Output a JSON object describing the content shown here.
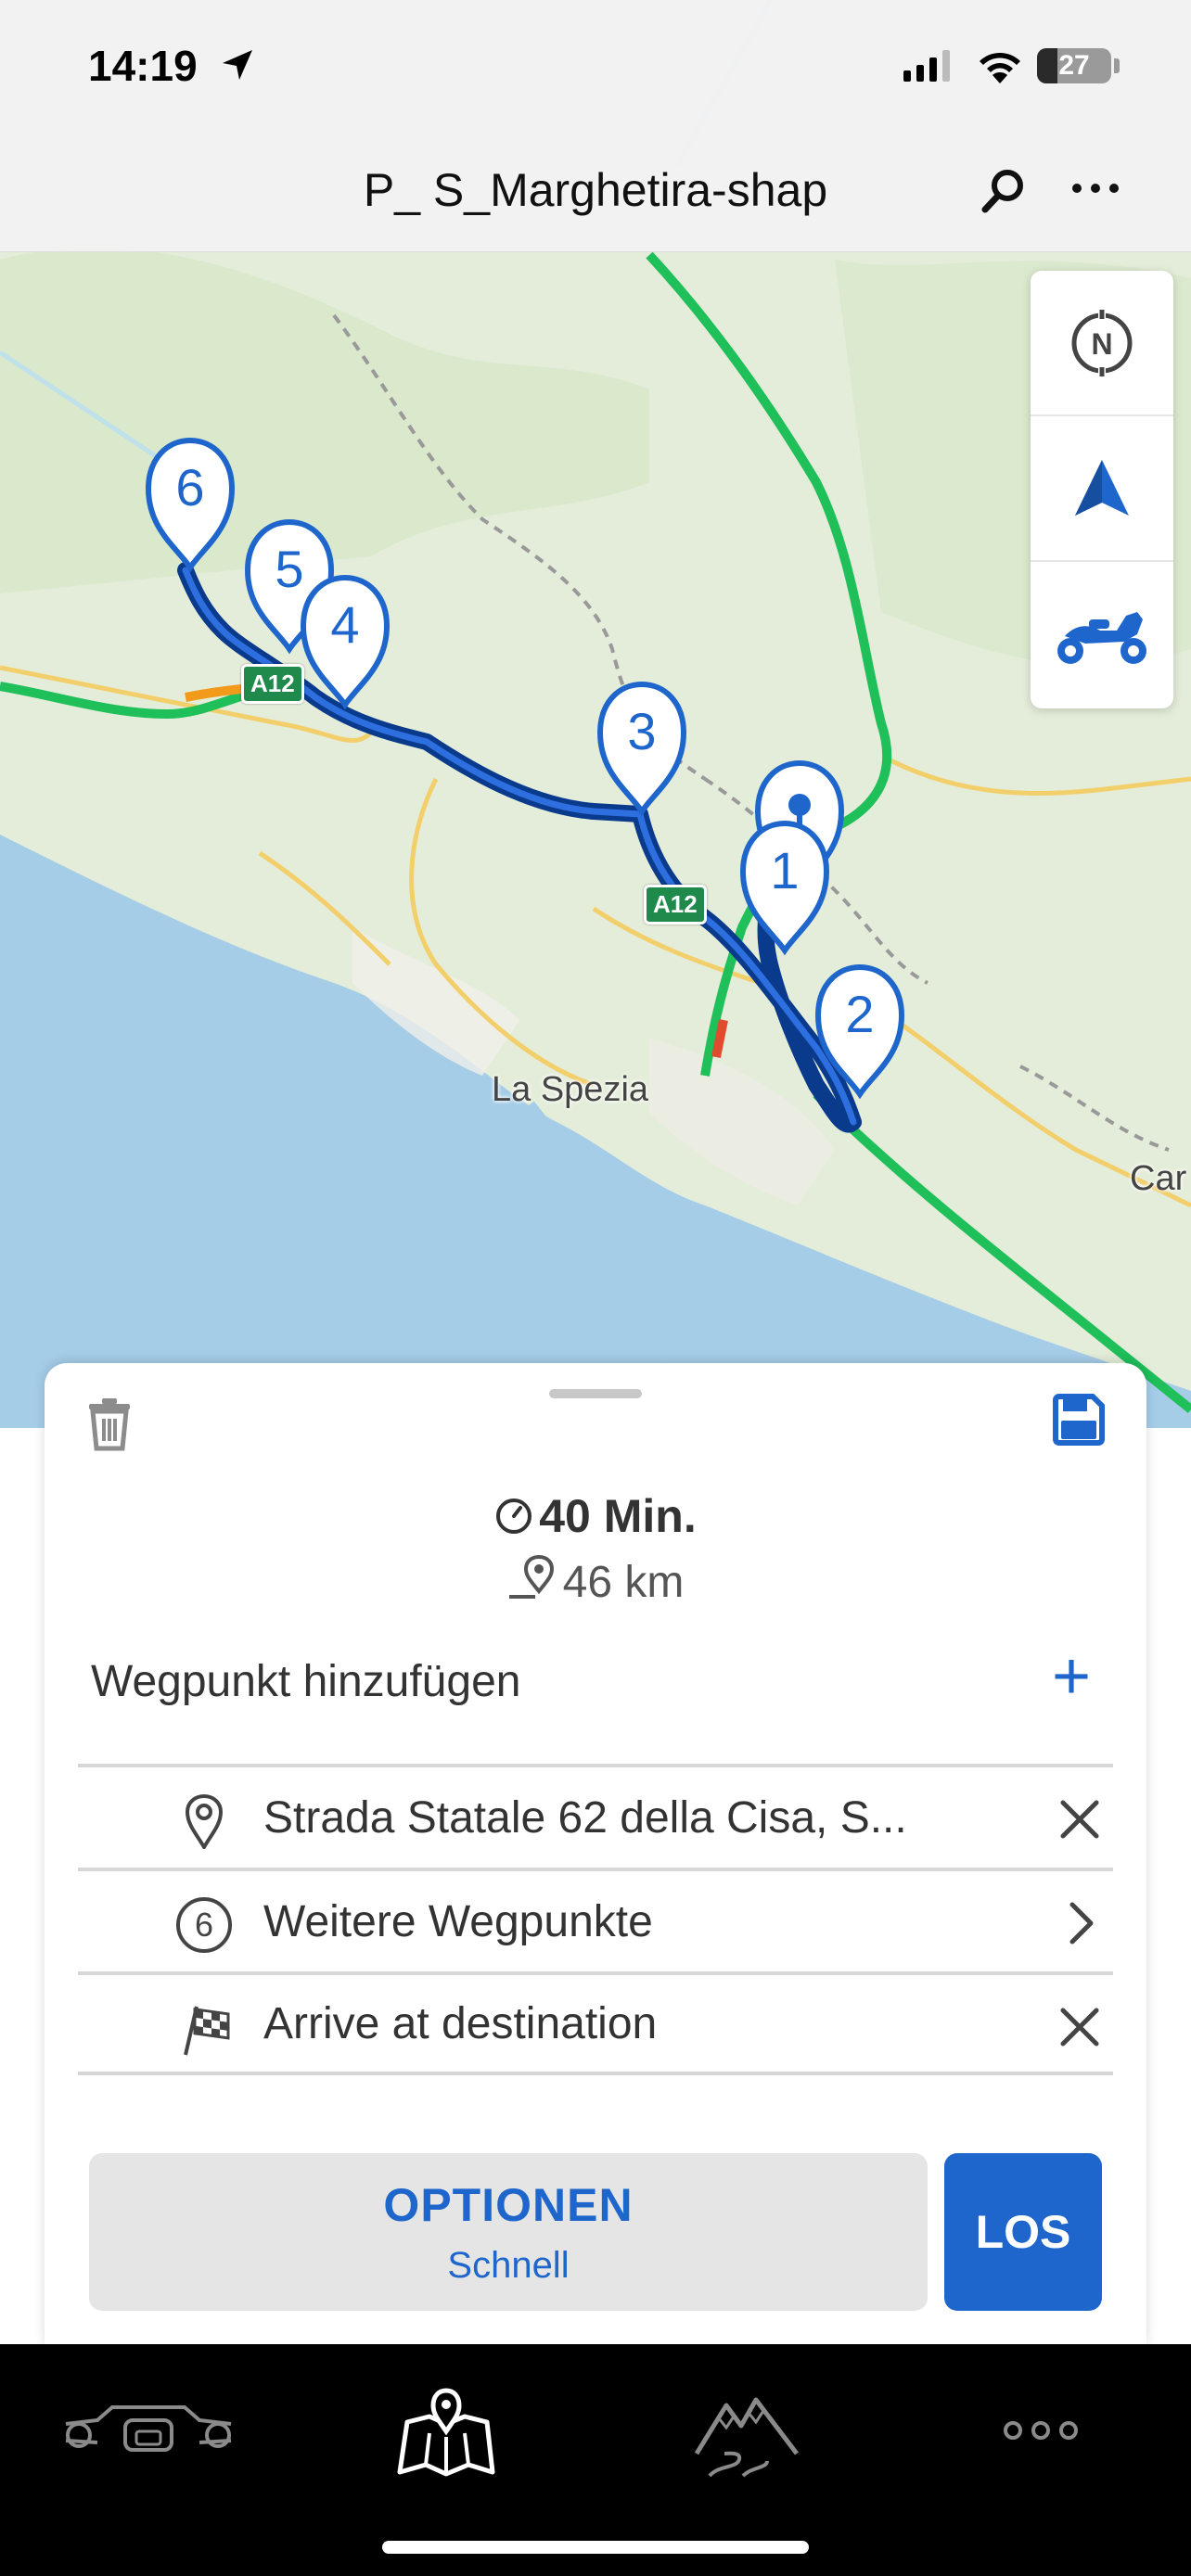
{
  "status_bar": {
    "time": "14:19",
    "battery": "27"
  },
  "header": {
    "title": "P_ S_Marghetira-shap"
  },
  "map": {
    "labels": [
      "La Spezia",
      "Car"
    ],
    "highway_shields": [
      "A12",
      "A12"
    ],
    "waypoint_markers": [
      "1",
      "2",
      "3",
      "4",
      "5",
      "6"
    ]
  },
  "route_summary": {
    "duration": "40 Min.",
    "distance": "46 km"
  },
  "add_waypoint_label": "Wegpunkt hinzufügen",
  "waypoints": [
    {
      "text": "Strada Statale 62 della Cisa, S...",
      "icon": "location-pin-icon",
      "action": "close-icon"
    },
    {
      "text": "Weitere Wegpunkte",
      "icon": "circled-number-icon",
      "badge": "6",
      "action": "chevron-right-icon"
    },
    {
      "text": "Arrive at destination",
      "icon": "checkered-flag-icon",
      "action": "close-icon"
    }
  ],
  "buttons": {
    "options_label": "OPTIONEN",
    "options_sub": "Schnell",
    "go_label": "LOS"
  },
  "tabs": [
    {
      "name": "motorcycle-dashboard-icon"
    },
    {
      "name": "map-pin-icon"
    },
    {
      "name": "mountain-road-icon"
    },
    {
      "name": "more-dots-icon"
    }
  ],
  "colors": {
    "accent": "#1f66cc",
    "route": "#0a3a8c",
    "highway": "#1fbf5a"
  }
}
